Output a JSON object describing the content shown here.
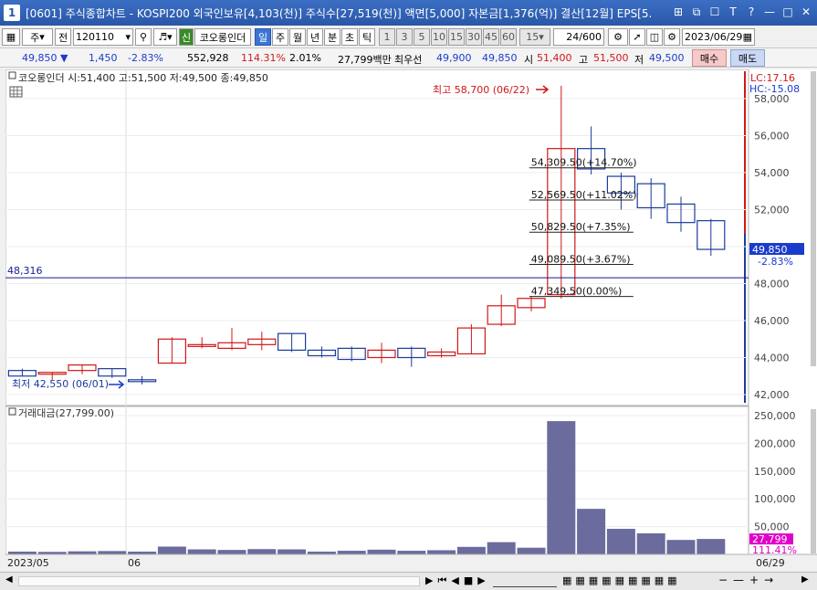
{
  "window": {
    "number": "1",
    "title": "[0601] 주식종합차트 - KOSPI200 외국인보유[4,103(천)] 주식수[27,519(천)] 액면[5,000] 자본금[1,376(억)] 결산[12월] EPS[5."
  },
  "toolbar": {
    "period_select": "주",
    "prev_label": "전",
    "code": "120110",
    "stock_badge": "신",
    "stock_name": "코오롱인더",
    "tabs": [
      "일",
      "주",
      "월",
      "년",
      "분",
      "초",
      "틱"
    ],
    "active_tab": "일",
    "numbers": [
      "1",
      "3",
      "5",
      "10",
      "15",
      "30",
      "45",
      "60"
    ],
    "interval": "15",
    "count": "24",
    "count_total": "/600",
    "date": "2023/06/29"
  },
  "quote": {
    "price": "49,850",
    "change": "1,450",
    "change_pct": "-2.83%",
    "volume": "552,928",
    "vol_ratio": "114.31%",
    "rate": "2.01%",
    "amount": "27,799백만",
    "best_ask_label": "최우선",
    "bid": "49,900",
    "ask": "49,850",
    "open_label": "시",
    "open": "51,400",
    "high_label": "고",
    "high": "51,500",
    "low_label": "저",
    "low": "49,500",
    "buy_label": "매수",
    "sell_label": "매도"
  },
  "chart": {
    "legend": "코오롱인더 시:51,400 고:51,500 저:49,500 종:49,850",
    "lc_label": "LC:17.16",
    "hc_label": "HC:-15.08",
    "high_note": "최고 58,700 (06/22)",
    "low_note": "최저 42,550 (06/01)",
    "hline_label": "48,316",
    "last_price": "49,850",
    "last_change": "-2.83%",
    "fib_labels": [
      "54,309.50(+14.70%)",
      "52,569.50(+11.02%)",
      "50,829.50(+7.35%)",
      "49,089.50(+3.67%)",
      "47,349.50(0.00%)"
    ],
    "volume_legend": "거래대금(27,799.00)",
    "last_volume": "27,799",
    "last_volume_pct": "111.41%",
    "x_labels": [
      "2023/05",
      "06"
    ],
    "x_right_label": "06/29",
    "colors": {
      "up": "#d01818",
      "down": "#1a3c9c",
      "volume": "#6b6b9e",
      "hline": "#1a1a8e"
    }
  },
  "chart_data": [
    {
      "type": "candlestick",
      "title": "코오롱인더",
      "ylim": [
        42000,
        59000
      ],
      "y_ticks": [
        42000,
        44000,
        46000,
        48000,
        50000,
        52000,
        54000,
        56000,
        58000
      ],
      "y_tick_labels": [
        "42,000",
        "44,000",
        "46,000",
        "48,000",
        "50,000",
        "52,000",
        "54,000",
        "56,000",
        "58,000"
      ],
      "horizontal_line": 48316,
      "candles": [
        {
          "o": 43300,
          "h": 43400,
          "l": 43000,
          "c": 43000
        },
        {
          "o": 43100,
          "h": 43200,
          "l": 42800,
          "c": 43200
        },
        {
          "o": 43300,
          "h": 43600,
          "l": 43100,
          "c": 43600
        },
        {
          "o": 43400,
          "h": 43400,
          "l": 42900,
          "c": 43000
        },
        {
          "o": 42800,
          "h": 43000,
          "l": 42550,
          "c": 42700
        },
        {
          "o": 43700,
          "h": 45100,
          "l": 43700,
          "c": 45000
        },
        {
          "o": 44600,
          "h": 45100,
          "l": 44500,
          "c": 44700
        },
        {
          "o": 44500,
          "h": 45600,
          "l": 44400,
          "c": 44800
        },
        {
          "o": 44700,
          "h": 45400,
          "l": 44400,
          "c": 45000
        },
        {
          "o": 45300,
          "h": 45300,
          "l": 44300,
          "c": 44400
        },
        {
          "o": 44400,
          "h": 44600,
          "l": 44000,
          "c": 44100
        },
        {
          "o": 44500,
          "h": 44600,
          "l": 43800,
          "c": 43900
        },
        {
          "o": 44000,
          "h": 44800,
          "l": 43700,
          "c": 44400
        },
        {
          "o": 44500,
          "h": 44600,
          "l": 43500,
          "c": 44000
        },
        {
          "o": 44100,
          "h": 44500,
          "l": 44000,
          "c": 44300
        },
        {
          "o": 44200,
          "h": 45800,
          "l": 44200,
          "c": 45600
        },
        {
          "o": 45800,
          "h": 47400,
          "l": 45700,
          "c": 46800
        },
        {
          "o": 46700,
          "h": 47300,
          "l": 46500,
          "c": 47200
        },
        {
          "o": 47400,
          "h": 58700,
          "l": 47200,
          "c": 55300
        },
        {
          "o": 55300,
          "h": 56500,
          "l": 53900,
          "c": 54200
        },
        {
          "o": 53800,
          "h": 54000,
          "l": 52000,
          "c": 52900
        },
        {
          "o": 53400,
          "h": 53700,
          "l": 51500,
          "c": 52100
        },
        {
          "o": 52300,
          "h": 52700,
          "l": 50800,
          "c": 51300
        },
        {
          "o": 51400,
          "h": 51500,
          "l": 49500,
          "c": 49850
        }
      ]
    },
    {
      "type": "bar",
      "title": "거래대금",
      "ylim": [
        0,
        250000
      ],
      "y_ticks": [
        0,
        50000,
        100000,
        150000,
        200000,
        250000
      ],
      "y_tick_labels": [
        "",
        "50,000",
        "100,000",
        "150,000",
        "200,000",
        "250,000"
      ],
      "values": [
        5000,
        4500,
        5500,
        6000,
        5000,
        14000,
        9000,
        8000,
        9500,
        9000,
        5000,
        6500,
        8500,
        6500,
        7500,
        13500,
        22000,
        12000,
        240000,
        82000,
        46000,
        38000,
        26000,
        27799
      ]
    }
  ]
}
